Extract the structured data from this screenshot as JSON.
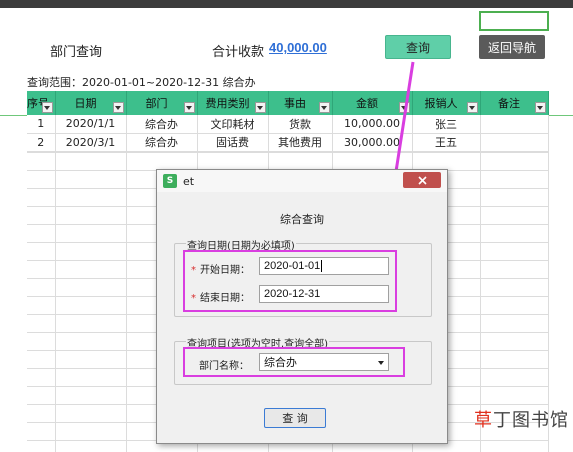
{
  "header": {
    "dept_title": "部门查询",
    "total_label": "合计收款",
    "total_value": "40,000.00",
    "query_button": "查询",
    "back_button": "返回导航"
  },
  "range_text": "查询范围：2020-01-01~2020-12-31 综合办",
  "table": {
    "columns": [
      "序号",
      "日期",
      "部门",
      "费用类别",
      "事由",
      "金额",
      "报销人",
      "备注"
    ],
    "rows": [
      {
        "seq": "1",
        "date": "2020/1/1",
        "dept": "综合办",
        "category": "文印耗材",
        "reason": "货款",
        "amount": "10,000.00",
        "person": "张三",
        "note": ""
      },
      {
        "seq": "2",
        "date": "2020/3/1",
        "dept": "综合办",
        "category": "固话费",
        "reason": "其他费用",
        "amount": "30,000.00",
        "person": "王五",
        "note": ""
      }
    ]
  },
  "dialog": {
    "app_badge": "S",
    "title": "et",
    "close_icon": "close-icon",
    "heading": "综合查询",
    "date_group_label": "查询日期(日期为必填项)",
    "start_label": "开始日期：",
    "start_value": "2020-01-01",
    "end_label": "结束日期：",
    "end_value": "2020-12-31",
    "item_group_label": "查询项目(选项为空时,查询全部)",
    "dept_label": "部门名称：",
    "dept_value": "综合办",
    "submit_button": "查 询"
  },
  "watermark": {
    "accent": "草",
    "rest": "丁图书馆"
  },
  "colors": {
    "header_green": "#3dbf8c",
    "query_button": "#5fcfa8",
    "back_button": "#5a5a5a",
    "total_value": "#2f6fd6",
    "highlight": "#d93ee0",
    "close_button": "#c0504d",
    "required_star": "#d62e2e"
  }
}
